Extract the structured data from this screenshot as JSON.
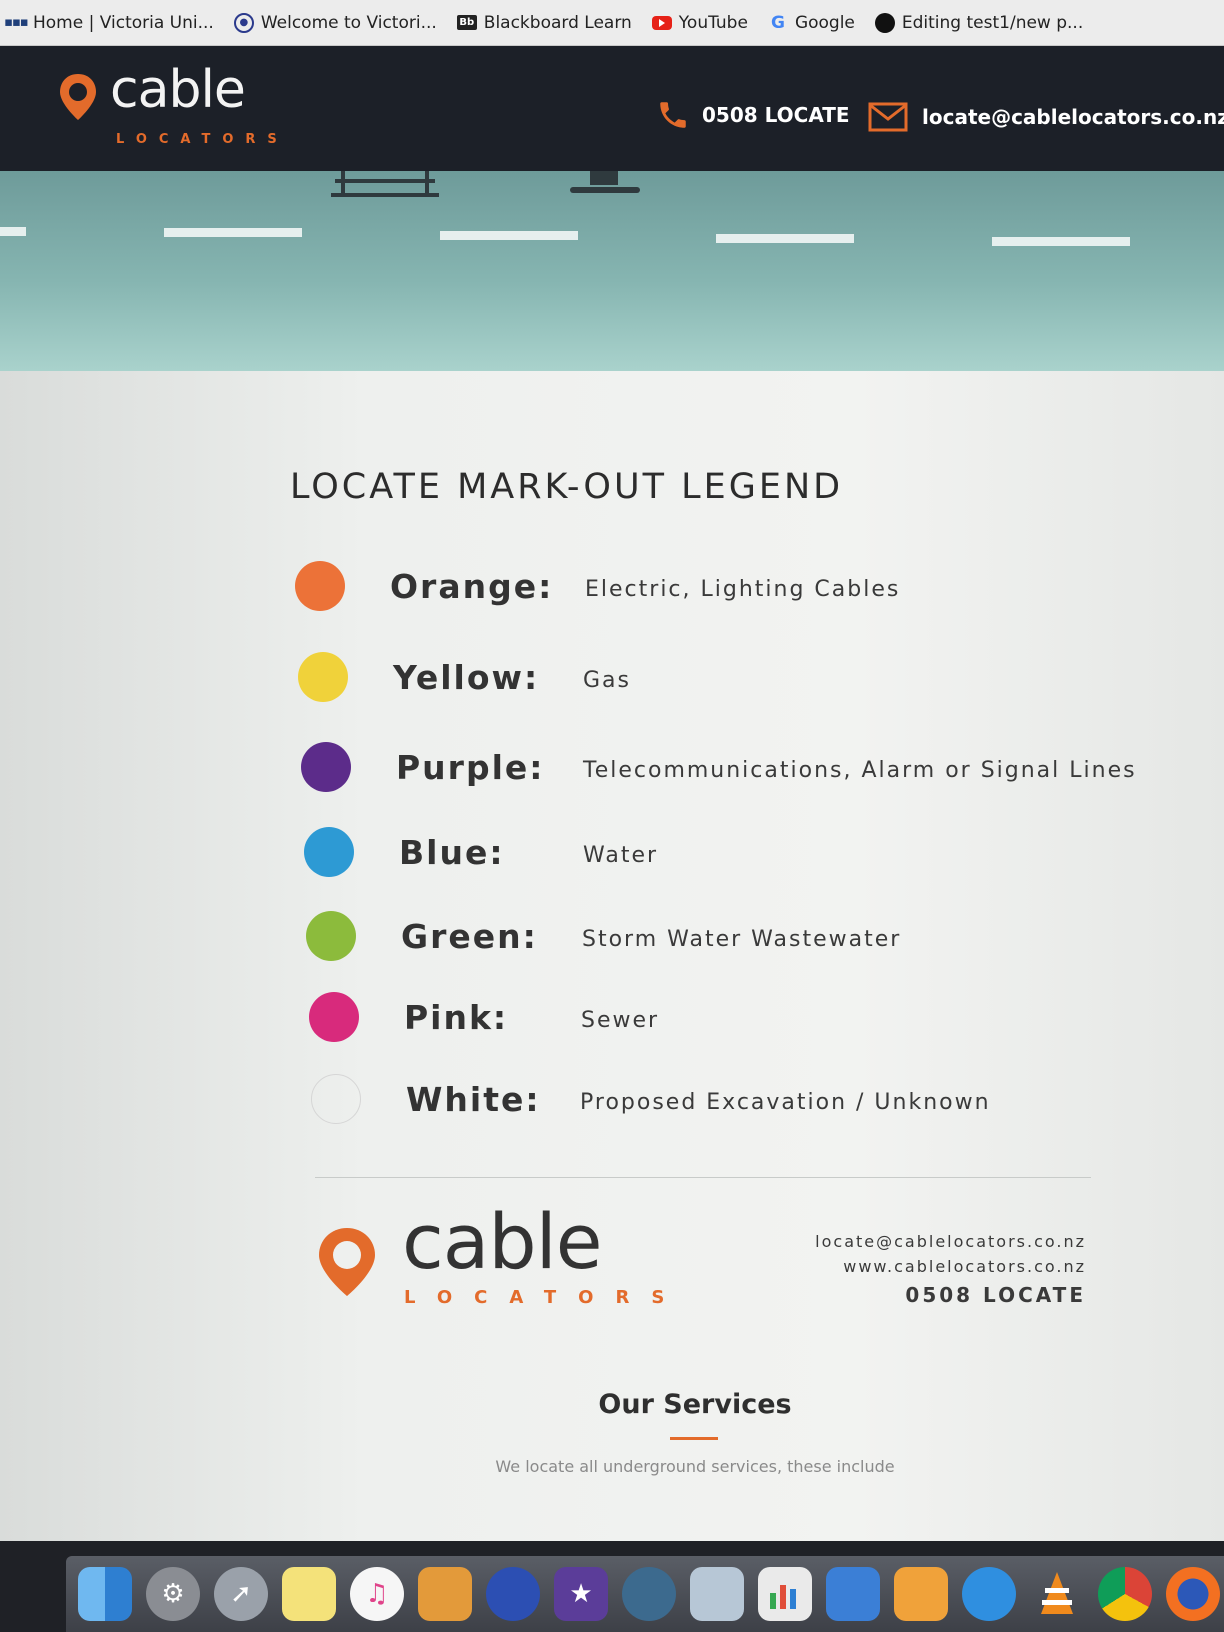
{
  "bookmarks": [
    {
      "label": "Home | Victoria Uni...",
      "icon": "vuw-icon"
    },
    {
      "label": "Welcome to Victori...",
      "icon": "circle-logo-icon"
    },
    {
      "label": "Blackboard Learn",
      "icon": "blackboard-icon",
      "icon_text": "Bb"
    },
    {
      "label": "YouTube",
      "icon": "youtube-icon"
    },
    {
      "label": "Google",
      "icon": "google-icon",
      "icon_text": "G"
    },
    {
      "label": "Editing test1/new p...",
      "icon": "github-icon"
    }
  ],
  "header": {
    "logo_word": "cable",
    "logo_sub": "LOCATORS",
    "phone": "0508 LOCATE",
    "email": "locate@cablelocators.co.nz",
    "accent": "#e36b2b",
    "background": "#1c2028"
  },
  "legend": {
    "title": "LOCATE MARK-OUT LEGEND",
    "items": [
      {
        "color_name": "Orange:",
        "description": "Electric, Lighting Cables",
        "swatch": "#ec7238"
      },
      {
        "color_name": "Yellow:",
        "description": "Gas",
        "swatch": "#f0d23a"
      },
      {
        "color_name": "Purple:",
        "description": "Telecommunications, Alarm or Signal Lines",
        "swatch": "#5c2c8a"
      },
      {
        "color_name": "Blue:",
        "description": "Water",
        "swatch": "#2d9ad4"
      },
      {
        "color_name": "Green:",
        "description": "Storm Water Wastewater",
        "swatch": "#8cbb3c"
      },
      {
        "color_name": "Pink:",
        "description": "Sewer",
        "swatch": "#d82a7c"
      },
      {
        "color_name": "White:",
        "description": "Proposed Excavation / Unknown",
        "swatch": "#ffffff"
      }
    ]
  },
  "footer_logo": {
    "word": "cable",
    "sub": "LOCATORS"
  },
  "footer_contact": {
    "email": "locate@cablelocators.co.nz",
    "website": "www.cablelocators.co.nz",
    "phone": "0508 LOCATE"
  },
  "services": {
    "title": "Our Services",
    "subtitle": "We locate all underground services, these include"
  },
  "dock": {
    "apps": [
      "finder-icon",
      "system-preferences-icon",
      "launchpad-icon",
      "notes-icon",
      "itunes-icon",
      "ibooks-icon",
      "podcast-icon",
      "imovie-icon",
      "migration-icon",
      "preview-icon",
      "numbers-icon",
      "keynote-icon",
      "pages-icon",
      "safari-icon",
      "vlc-icon",
      "chrome-icon",
      "firefox-icon"
    ]
  }
}
